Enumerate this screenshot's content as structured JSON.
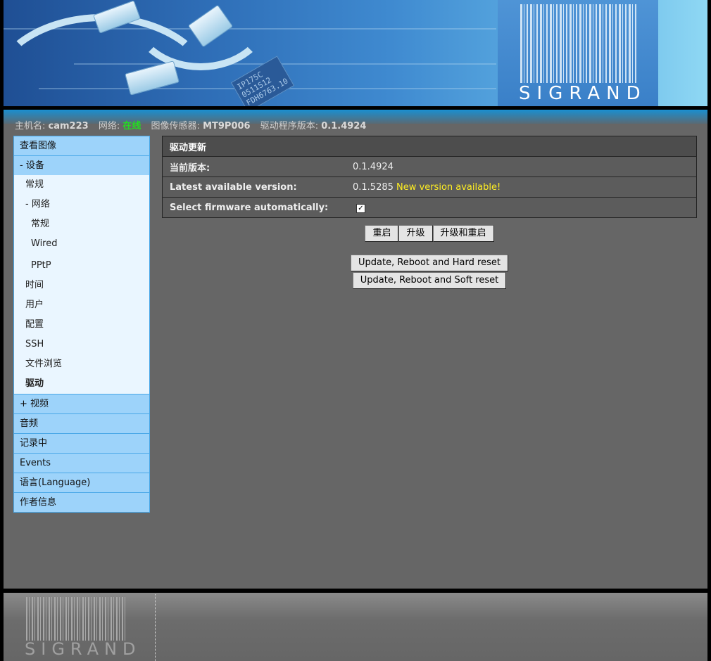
{
  "banner": {
    "logo_text": "SIGRAND",
    "chip_text": "IP175C\n0511S12\nFDH6763.10"
  },
  "status": {
    "hostname_label": "主机名:",
    "hostname_value": "cam223",
    "network_label": "网络:",
    "network_value": "在线",
    "sensor_label": "图像传感器:",
    "sensor_value": "MT9P006",
    "driver_label": "驱动程序版本:",
    "driver_value": "0.1.4924"
  },
  "sidebar": {
    "view_image": "查看图像",
    "device": "- 设备",
    "general": "常规",
    "network": "- 网络",
    "net_general": "常规",
    "wired": "Wired",
    "pptp": "PPtP",
    "time": "时间",
    "users": "用户",
    "config": "配置",
    "ssh": "SSH",
    "file_browse": "文件浏览",
    "driver": "驱动",
    "video": "+ 视频",
    "audio": "音频",
    "recording": "记录中",
    "events": "Events",
    "language": "语言(Language)",
    "author_info": "作者信息"
  },
  "update": {
    "title": "驱动更新",
    "current_label": "当前版本:",
    "current_value": "0.1.4924",
    "latest_label": "Latest available version:",
    "latest_value": "0.1.5285",
    "latest_note": "New version available!",
    "auto_label": "Select firmware automatically:",
    "auto_checked": true,
    "btn_reboot": "重启",
    "btn_upgrade": "升级",
    "btn_upgrade_reboot": "升级和重启",
    "btn_hard_reset": "Update, Reboot and Hard reset",
    "btn_soft_reset": "Update, Reboot and Soft reset"
  },
  "footer": {
    "logo_text": "SIGRAND"
  },
  "colors": {
    "online": "#22dd22",
    "new_version": "#ffee22",
    "nav_blue": "#9dd3fa",
    "panel_gray": "#666666"
  }
}
